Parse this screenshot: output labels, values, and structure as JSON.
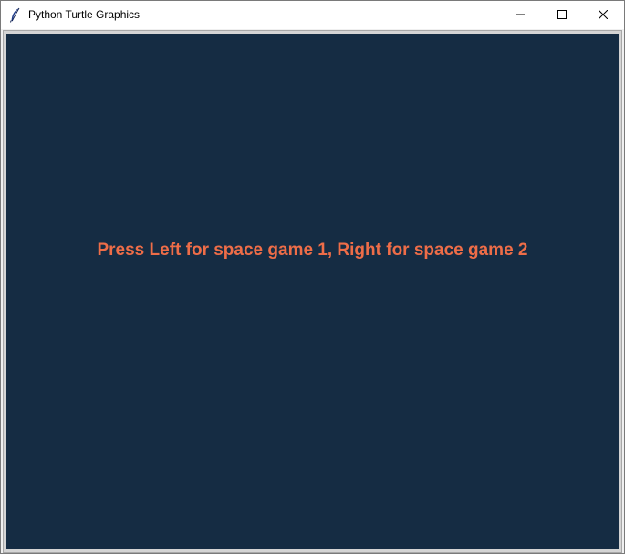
{
  "window": {
    "title": "Python Turtle Graphics",
    "app_icon": "feather-icon",
    "controls": {
      "minimize_icon": "minimize-icon",
      "maximize_icon": "maximize-icon",
      "close_icon": "close-icon"
    }
  },
  "canvas": {
    "background_color": "#152c43",
    "message": "Press Left for space game 1, Right for space game 2",
    "message_color": "#ee6d48"
  }
}
